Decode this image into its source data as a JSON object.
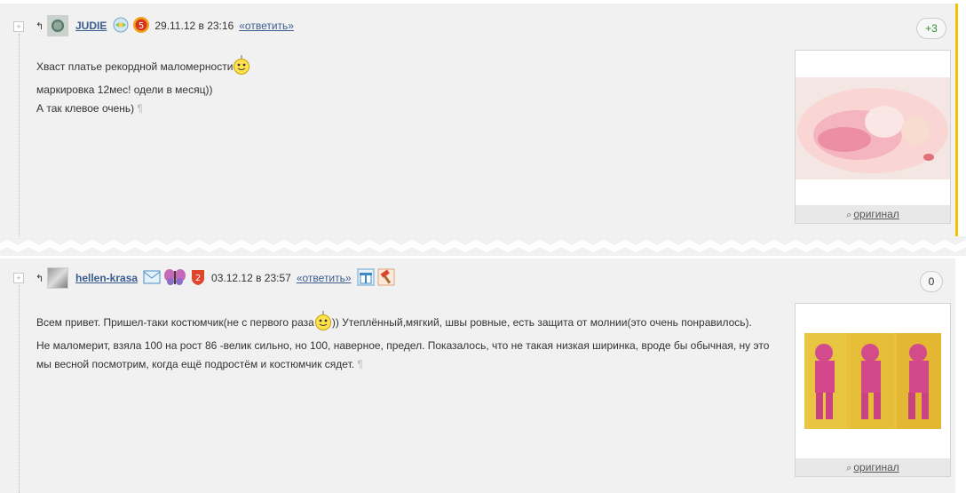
{
  "comments": [
    {
      "username": "JUDIE",
      "date": "29.11.12 в 23:16",
      "reply": "«ответить»",
      "rating": "+3",
      "lines": [
        "Хваст платье рекордной маломерности",
        "маркировка 12мес! одели в месяц))",
        "А так клевое очень)"
      ],
      "badge_number": "5",
      "original_label": "оригинал"
    },
    {
      "username": "hellen-krasa",
      "date": "03.12.12 в 23:57",
      "reply": "«ответить»",
      "rating": "0",
      "lines": [
        "Всем привет. Пришел-таки костюмчик(не с первого раза",
        ")) Утеплённый,мягкий, швы ровные, есть защита от молнии(это очень понравилось).",
        "Не маломерит, взяла 100 на рост 86 -велик сильно, но 100, наверное, предел. Показалось, что не такая низкая ширинка, вроде бы обычная, ну это",
        "мы весной посмотрим, когда ещё подростём и костюмчик сядет."
      ],
      "badge_number": "2",
      "original_label": "оригинал"
    }
  ],
  "symbols": {
    "toggle": "+",
    "reply_arrow": "↰",
    "pilcrow": "¶",
    "magnifier": "⌕"
  },
  "colors": {
    "accent": "#f2c200",
    "link": "#3a5d8f",
    "background": "#f1f1f1"
  },
  "icons": [
    "avatar",
    "globe-badge-icon",
    "medal-5-icon",
    "smiley-icon",
    "mail-icon",
    "butterfly-icon",
    "medal-2-icon",
    "gift-icon",
    "hammer-icon",
    "magnifier-icon"
  ]
}
